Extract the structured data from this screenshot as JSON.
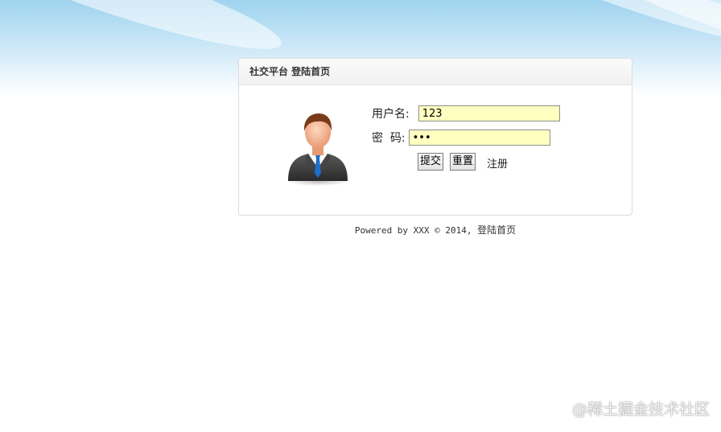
{
  "panel": {
    "title": "社交平台 登陆首页"
  },
  "form": {
    "username_label": "用户名:",
    "username_value": "123",
    "password_label": "密  码:",
    "password_value": "123",
    "submit_label": "提交",
    "reset_label": "重置",
    "register_label": "注册"
  },
  "footer": {
    "powered_text": "Powered by XXX © 2014, ",
    "link_text": "登陆首页"
  },
  "watermark": {
    "text": "@稀土掘金技术社区"
  },
  "colors": {
    "input_background": "#ffffc0",
    "sky_top": "#9fd3ef"
  },
  "icons": {
    "avatar": "businessman-avatar-icon"
  }
}
